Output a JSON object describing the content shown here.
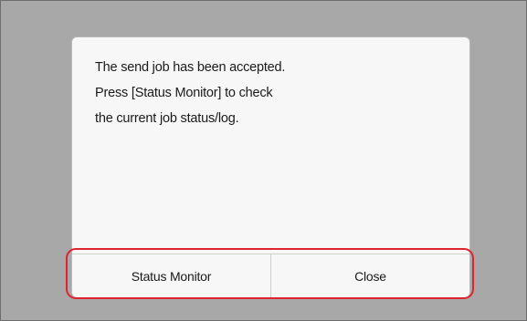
{
  "dialog": {
    "message_lines": [
      "The send job has been accepted.",
      "Press [Status Monitor] to check",
      "the current job status/log."
    ]
  },
  "buttons": {
    "status_monitor": "Status Monitor",
    "close": "Close"
  },
  "colors": {
    "background": "#a8a8a8",
    "dialog": "#f7f7f7",
    "highlight": "#e0222f"
  }
}
